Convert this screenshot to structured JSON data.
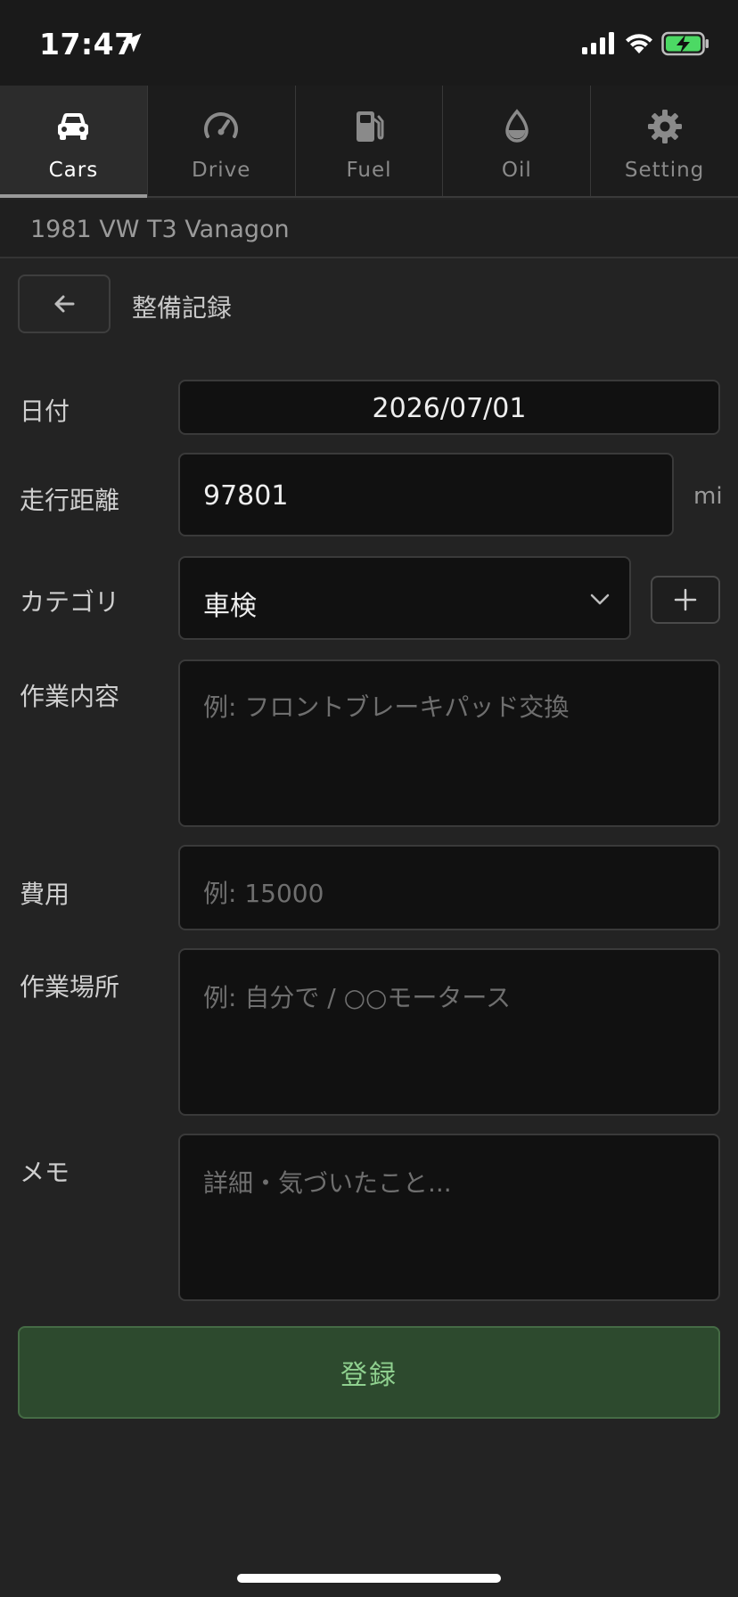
{
  "status_bar": {
    "time": "17:47"
  },
  "tabs": [
    {
      "label": "Cars",
      "icon": "car-icon",
      "active": true
    },
    {
      "label": "Drive",
      "icon": "speedometer-icon",
      "active": false
    },
    {
      "label": "Fuel",
      "icon": "fuel-pump-icon",
      "active": false
    },
    {
      "label": "Oil",
      "icon": "oil-drop-icon",
      "active": false
    },
    {
      "label": "Setting",
      "icon": "gear-icon",
      "active": false
    }
  ],
  "car": {
    "name": "1981 VW T3 Vanagon"
  },
  "page": {
    "title": "整備記録"
  },
  "form": {
    "date": {
      "label": "日付",
      "value": "2026/07/01"
    },
    "mileage": {
      "label": "走行距離",
      "value": "97801",
      "unit": "mi"
    },
    "category": {
      "label": "カテゴリ",
      "value": "車検"
    },
    "work": {
      "label": "作業内容",
      "placeholder": "例: フロントブレーキパッド交換"
    },
    "cost": {
      "label": "費用",
      "placeholder": "例: 15000"
    },
    "place": {
      "label": "作業場所",
      "placeholder": "例: 自分で / ○○モータース"
    },
    "memo": {
      "label": "メモ",
      "placeholder": "詳細・気づいたこと..."
    },
    "submit_label": "登録"
  },
  "colors": {
    "accent_green": "#2d4a2e",
    "submit_text": "#8fd08f",
    "background": "#232323"
  }
}
